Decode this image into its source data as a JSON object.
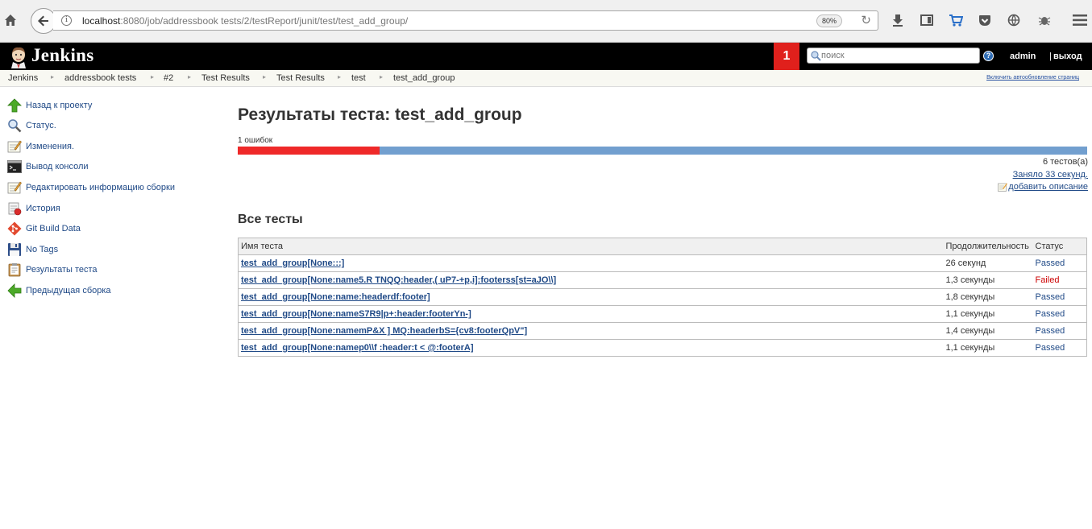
{
  "browser": {
    "url_host": "localhost",
    "url_path": ":8080/job/addressbook tests/2/testReport/junit/test/test_add_group/",
    "zoom": "80%"
  },
  "header": {
    "app_title": "Jenkins",
    "notification_count": "1",
    "search_placeholder": "поиск",
    "help": "?",
    "user": "admin",
    "separator": "|",
    "logout": "выход"
  },
  "breadcrumbs": [
    "Jenkins",
    "addressbook tests",
    "#2",
    "Test Results",
    "Test Results",
    "test",
    "test_add_group"
  ],
  "auto_refresh": "Включить автообновление страниц",
  "sidebar": {
    "items": [
      {
        "label": "Назад к проекту",
        "icon": "up-arrow-icon"
      },
      {
        "label": "Статус.",
        "icon": "magnifier-icon"
      },
      {
        "label": "Изменения.",
        "icon": "notepad-icon"
      },
      {
        "label": "Вывод консоли",
        "icon": "terminal-icon"
      },
      {
        "label": "Редактировать информацию сборки",
        "icon": "edit-notepad-icon"
      },
      {
        "label": "История",
        "icon": "history-icon"
      },
      {
        "label": "Git Build Data",
        "icon": "git-icon"
      },
      {
        "label": "No Tags",
        "icon": "floppy-icon"
      },
      {
        "label": "Результаты теста",
        "icon": "clipboard-icon"
      },
      {
        "label": "Предыдущая сборка",
        "icon": "left-arrow-icon"
      }
    ]
  },
  "main": {
    "title": "Результаты теста: test_add_group",
    "fail_summary": "1 ошибок",
    "fail_fraction": 0.1667,
    "test_count": "6 тестов(а)",
    "duration": "Заняло 33 секунд.",
    "add_description": "добавить описание",
    "section_title": "Все тесты",
    "table": {
      "headers": [
        "Имя теста",
        "Продолжительность",
        "Статус"
      ],
      "rows": [
        {
          "name": "test_add_group[None:::]",
          "duration": "26 секунд",
          "status": "Passed"
        },
        {
          "name": "test_add_group[None:name5.R TNQQ:header,( uP7-+p,i]:footerss[st=aJO\\\\]",
          "duration": "1,3 секунды",
          "status": "Failed"
        },
        {
          "name": "test_add_group[None:name:headerdf:footer]",
          "duration": "1,8 секунды",
          "status": "Passed"
        },
        {
          "name": "test_add_group[None:nameS7R9|p+:header:footerYn-]",
          "duration": "1,1 секунды",
          "status": "Passed"
        },
        {
          "name": "test_add_group[None:namemP&X ] MQ:headerbS={cv8:footerQpV\"]",
          "duration": "1,4 секунды",
          "status": "Passed"
        },
        {
          "name": "test_add_group[None:namep0\\\\f :header:t < @:footerA]",
          "duration": "1,1 секунды",
          "status": "Passed"
        }
      ]
    }
  },
  "colors": {
    "fail": "#ef2929",
    "pass_bar": "#729fcf",
    "link": "#204a87",
    "failed_text": "#cc0000",
    "notification": "#e0201c"
  }
}
